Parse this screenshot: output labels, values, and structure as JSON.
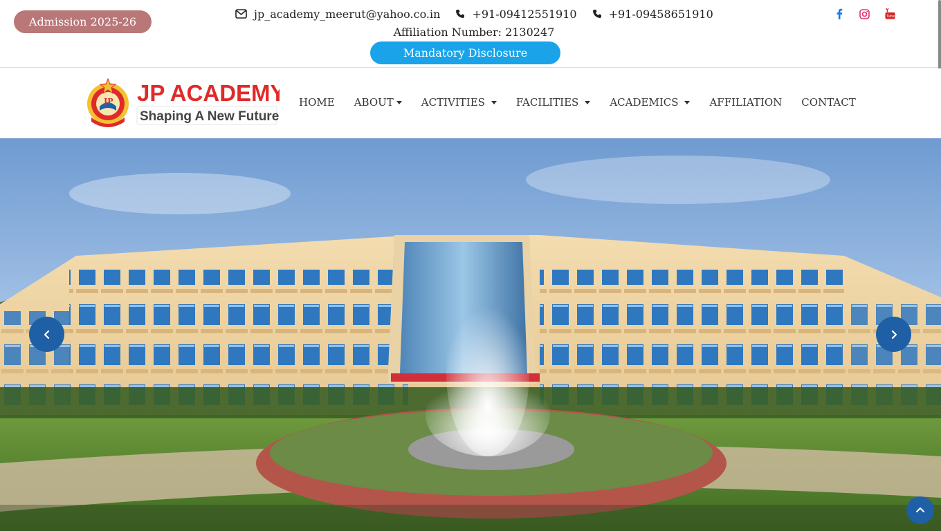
{
  "header": {
    "admission_label": "Admission 2025-26",
    "email": "jp_academy_meerut@yahoo.co.in",
    "phone_1": "+91-09412551910",
    "phone_2": "+91-09458651910",
    "affiliation_text": "Affiliation Number: 2130247",
    "disclosure_label": "Mandatory Disclosure",
    "social": [
      "facebook-icon",
      "instagram-icon",
      "youtube-icon"
    ]
  },
  "logo": {
    "title": "JP ACADEMY",
    "tagline": "Shaping A New Future",
    "emblem_text": "ACADEMY"
  },
  "nav": {
    "items": [
      {
        "label": "HOME",
        "dropdown": false
      },
      {
        "label": "ABOUT",
        "dropdown": true
      },
      {
        "label": "ACTIVITIES",
        "dropdown": true
      },
      {
        "label": "FACILITIES",
        "dropdown": true
      },
      {
        "label": "ACADEMICS",
        "dropdown": true
      },
      {
        "label": "AFFILIATION",
        "dropdown": false
      },
      {
        "label": "CONTACT",
        "dropdown": false
      }
    ]
  },
  "colors": {
    "admission_bg": "#b97778",
    "disclosure_bg": "#1aa3e8",
    "carousel_btn": "#1f5fa6",
    "logo_red": "#e02a2a",
    "social_facebook": "#1877f2",
    "social_instagram": "#e1306c",
    "social_youtube": "#d62222"
  }
}
